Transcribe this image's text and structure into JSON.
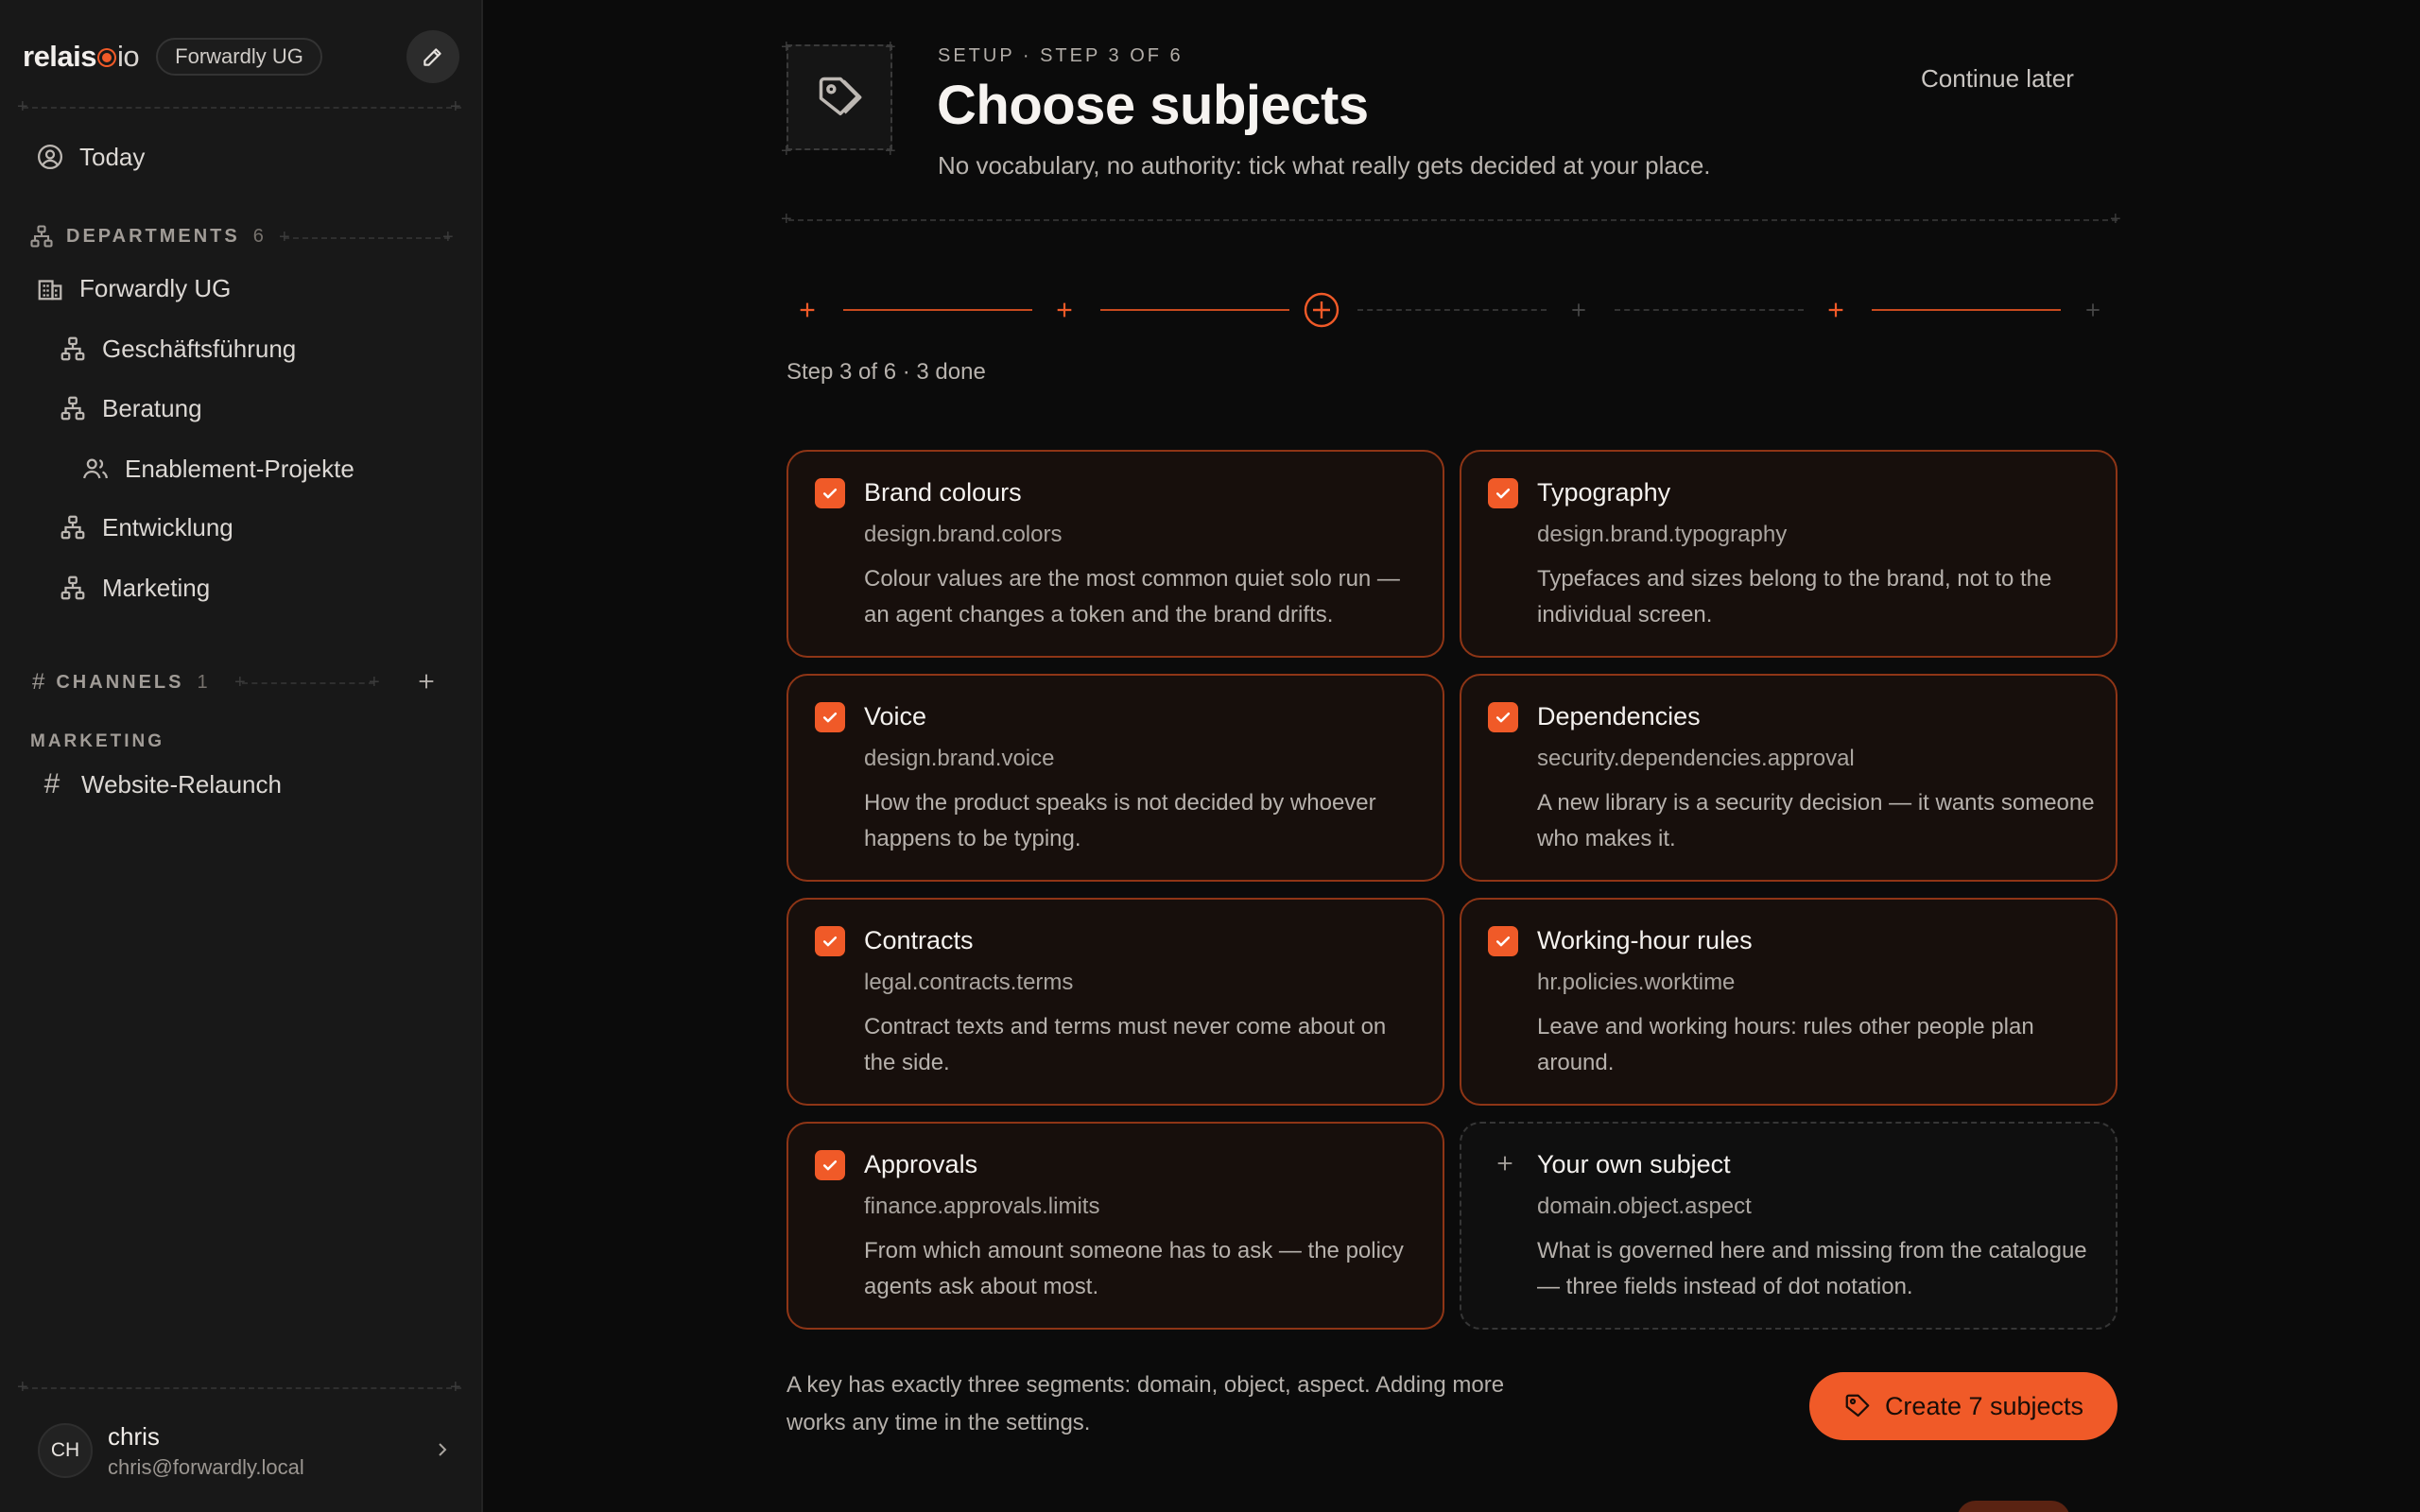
{
  "sidebar": {
    "logo": {
      "left": "relais",
      "right": "io"
    },
    "org_pill": "Forwardly UG",
    "today_label": "Today",
    "departments": {
      "heading": "DEPARTMENTS",
      "count": "6",
      "items": [
        {
          "label": "Forwardly UG",
          "icon": "building-icon"
        },
        {
          "label": "Geschäftsführung",
          "icon": "org-chart-icon"
        },
        {
          "label": "Beratung",
          "icon": "org-chart-icon"
        },
        {
          "label": "Enablement-Projekte",
          "icon": "team-icon"
        },
        {
          "label": "Entwicklung",
          "icon": "org-chart-icon"
        },
        {
          "label": "Marketing",
          "icon": "org-chart-icon"
        }
      ]
    },
    "channels": {
      "heading": "CHANNELS",
      "count": "1",
      "group": "MARKETING",
      "items": [
        {
          "label": "Website-Relaunch",
          "icon": "hash-icon"
        }
      ]
    },
    "user": {
      "initials": "CH",
      "name": "chris",
      "email": "chris@forwardly.local"
    }
  },
  "header": {
    "eyebrow": "SETUP · STEP 3 OF 6",
    "title": "Choose subjects",
    "subtitle": "No vocabulary, no authority: tick what really gets decided at your place.",
    "continue_later": "Continue later",
    "icon": "tag-icon"
  },
  "stepper": {
    "status": "Step 3 of 6 · 3 done",
    "current_step": 3,
    "total_steps": 6,
    "done_steps": [
      1,
      2,
      5
    ]
  },
  "subjects": [
    {
      "title": "Brand colours",
      "key": "design.brand.colors",
      "desc": "Colour values are the most common quiet solo run — an agent changes a token and the brand drifts.",
      "checked": true
    },
    {
      "title": "Typography",
      "key": "design.brand.typography",
      "desc": "Typefaces and sizes belong to the brand, not to the individual screen.",
      "checked": true
    },
    {
      "title": "Voice",
      "key": "design.brand.voice",
      "desc": "How the product speaks is not decided by whoever happens to be typing.",
      "checked": true
    },
    {
      "title": "Dependencies",
      "key": "security.dependencies.approval",
      "desc": "A new library is a security decision — it wants someone who makes it.",
      "checked": true
    },
    {
      "title": "Contracts",
      "key": "legal.contracts.terms",
      "desc": "Contract texts and terms must never come about on the side.",
      "checked": true
    },
    {
      "title": "Working-hour rules",
      "key": "hr.policies.worktime",
      "desc": "Leave and working hours: rules other people plan around.",
      "checked": true
    },
    {
      "title": "Approvals",
      "key": "finance.approvals.limits",
      "desc": "From which amount someone has to ask — the policy agents ask about most.",
      "checked": true
    }
  ],
  "custom_subject": {
    "title": "Your own subject",
    "key": "domain.object.aspect",
    "desc": "What is governed here and missing from the catalogue — three fields instead of dot notation."
  },
  "footer": {
    "note": "A key has exactly three segments: domain, object, aspect. Adding more works any time in the settings.",
    "create_button": "Create 7 subjects"
  },
  "colors": {
    "accent": "#f05a28",
    "card_border": "#8e3516",
    "background": "#0b0b0b",
    "sidebar": "#181818"
  }
}
